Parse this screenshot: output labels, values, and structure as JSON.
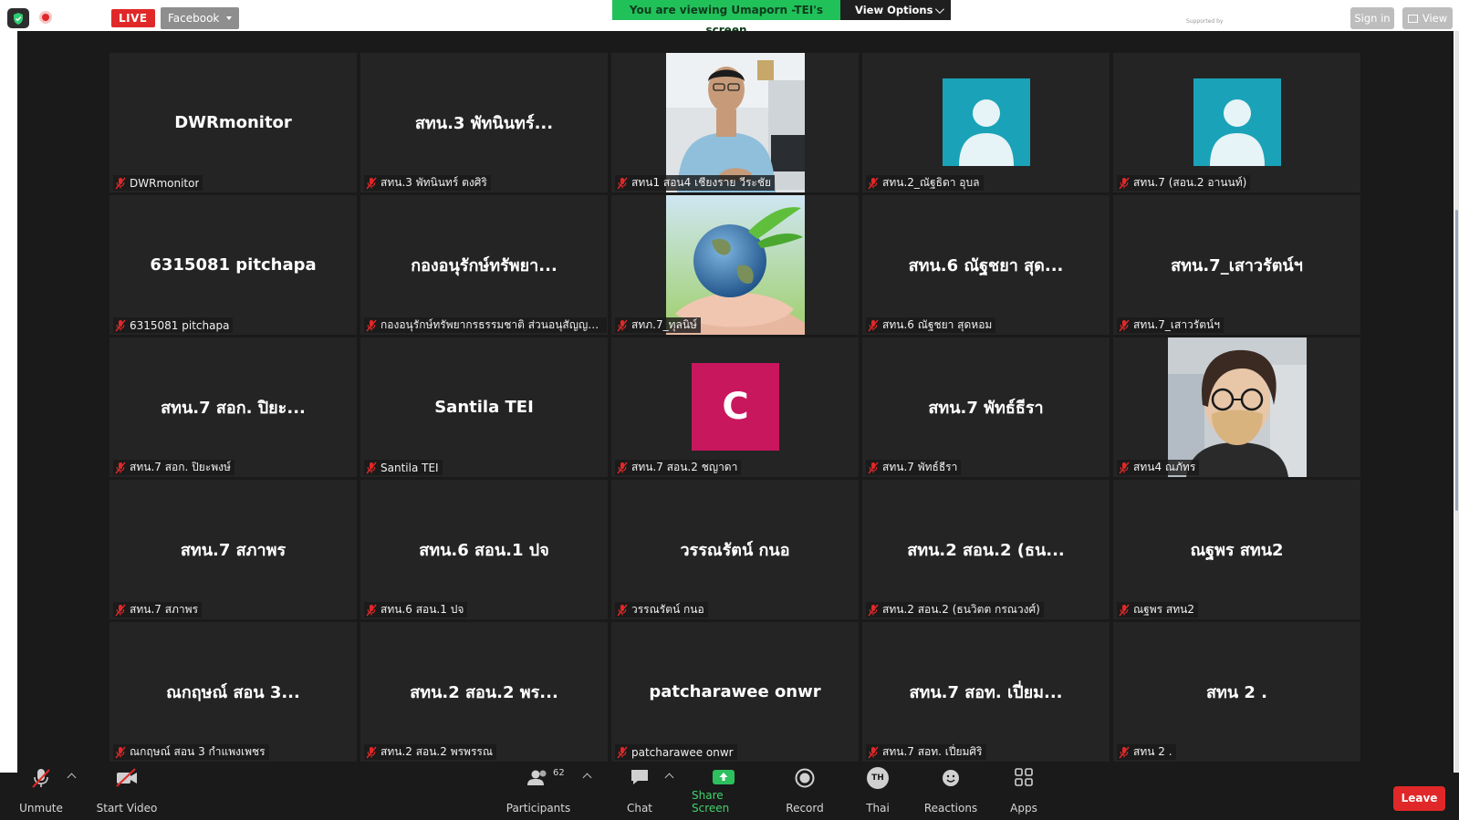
{
  "topbar": {
    "live_label": "LIVE",
    "stream_target": "Facebook",
    "viewing_banner": "You are viewing Umaporn -TEI's screen",
    "view_options_label": "View Options",
    "signin_label": "Sign in",
    "view_label": "View",
    "supported_text": "Supported by"
  },
  "participants": [
    {
      "display": "DWRmonitor",
      "label": "DWRmonitor",
      "tile": "name"
    },
    {
      "display": "สทน.3  พัทนินทร์...",
      "label": "สทน.3  พัทนินทร์ ตงศิริ",
      "tile": "name"
    },
    {
      "display": "",
      "label": "สทน1 สอน4 เชียงราย วีระชัย",
      "tile": "photo-man"
    },
    {
      "display": "",
      "label": "สทน.2_ณัฐธิดา อุบล",
      "tile": "avatar"
    },
    {
      "display": "",
      "label": "สทน.7 (สอน.2 อานนท์)",
      "tile": "avatar"
    },
    {
      "display": "6315081 pitchapa",
      "label": "6315081 pitchapa",
      "tile": "name"
    },
    {
      "display": "กองอนุรักษ์ทรัพยา...",
      "label": "กองอนุรักษ์ทรัพยากรธรรมชาติ ส่วนอนุสัญญาพื้...",
      "tile": "name"
    },
    {
      "display": "",
      "label": "สทภ.7_ทุลนิษ์",
      "tile": "photo-earth"
    },
    {
      "display": "สทน.6 ณัฐชยา สุด...",
      "label": "สทน.6 ณัฐชยา สุดหอม",
      "tile": "name"
    },
    {
      "display": "สทน.7_เสาวรัตน์ฯ",
      "label": "สทน.7_เสาวรัตน์ฯ",
      "tile": "name"
    },
    {
      "display": "สทน.7 สอก. ปิยะ...",
      "label": "สทน.7 สอก. ปิยะพงษ์",
      "tile": "name"
    },
    {
      "display": "Santila TEI",
      "label": "Santila TEI",
      "tile": "name"
    },
    {
      "display": "C",
      "label": "สทน.7 สอน.2 ชญาดา",
      "tile": "letter"
    },
    {
      "display": "สทน.7 พัทธ์ธีรา",
      "label": "สทน.7 พัทธ์ธีรา",
      "tile": "name"
    },
    {
      "display": "",
      "label": "สทน4 ณภัทร",
      "tile": "photo-woman"
    },
    {
      "display": "สทน.7 สภาพร",
      "label": "สทน.7 สภาพร",
      "tile": "name"
    },
    {
      "display": "สทน.6 สอน.1 ปจ",
      "label": "สทน.6 สอน.1 ปจ",
      "tile": "name"
    },
    {
      "display": "วรรณรัตน์ กนอ",
      "label": "วรรณรัตน์ กนอ",
      "tile": "name"
    },
    {
      "display": "สทน.2 สอน.2 (ธน...",
      "label": "สทน.2 สอน.2 (ธนวิตต กรณวงศ์)",
      "tile": "name"
    },
    {
      "display": "ณฐพร สทน2",
      "label": "ณฐพร สทน2",
      "tile": "name"
    },
    {
      "display": "ณกฤษณ์ สอน 3...",
      "label": "ณกฤษณ์ สอน 3 กำแพงเพชร",
      "tile": "name"
    },
    {
      "display": "สทน.2 สอน.2 พร...",
      "label": "สทน.2 สอน.2 พรพรรณ",
      "tile": "name"
    },
    {
      "display": "patcharawee onwr",
      "label": "patcharawee onwr",
      "tile": "name"
    },
    {
      "display": "สทน.7 สอท. เปี่ยม...",
      "label": "สทน.7 สอท. เปี่ยมศิริ",
      "tile": "name"
    },
    {
      "display": "สทน 2 .",
      "label": "สทน 2 .",
      "tile": "name"
    }
  ],
  "toolbar": {
    "unmute": "Unmute",
    "start_video": "Start Video",
    "participants": "Participants",
    "participants_count": "62",
    "chat": "Chat",
    "share_screen": "Share Screen",
    "record": "Record",
    "language": "Thai",
    "language_code": "TH",
    "reactions": "Reactions",
    "apps": "Apps",
    "leave": "Leave"
  },
  "colors": {
    "live_red": "#e02828",
    "viewing_green": "#21c15a",
    "share_green": "#3fd36d",
    "avatar_teal": "#1aa3b8",
    "avatar_c": "#c9175e"
  }
}
